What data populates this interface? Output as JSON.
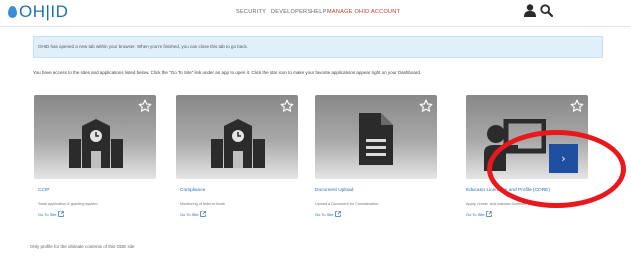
{
  "header": {
    "logo_text": "OH|ID",
    "nav": [
      "SECURITY",
      "DEVELOPERS",
      "HELP"
    ],
    "manage": "MANAGE OHID ACCOUNT"
  },
  "banner": {
    "text": "OHID has opened a new tab within your browser. When you're finished, you can close this tab to go back."
  },
  "intro": "You have access to the sites and applications listed below. Click the \"Go To Site\" link under an app to open it. Click the star icon to make your favorite applications appear right on your Dashboard.",
  "cards": [
    {
      "title": "CCIP",
      "desc": "State application & granting system",
      "link": "Go To Site",
      "icon": "school-building-icon"
    },
    {
      "title": "Compliance",
      "desc": "Monitoring of federal funds",
      "link": "Go To Site",
      "icon": "school-building-icon"
    },
    {
      "title": "Document Upload",
      "desc": "Upload a Document for Consideration",
      "link": "Go To Site",
      "icon": "document-icon"
    },
    {
      "title": "Educator Licensure and Profile (CORE)",
      "desc": "Apply, renew, and maintain licenses",
      "link": "Go To Site",
      "icon": "teacher-board-icon"
    }
  ],
  "next_button": "›",
  "footer_note": "Only profile for the ultimate contents of this ODE site"
}
